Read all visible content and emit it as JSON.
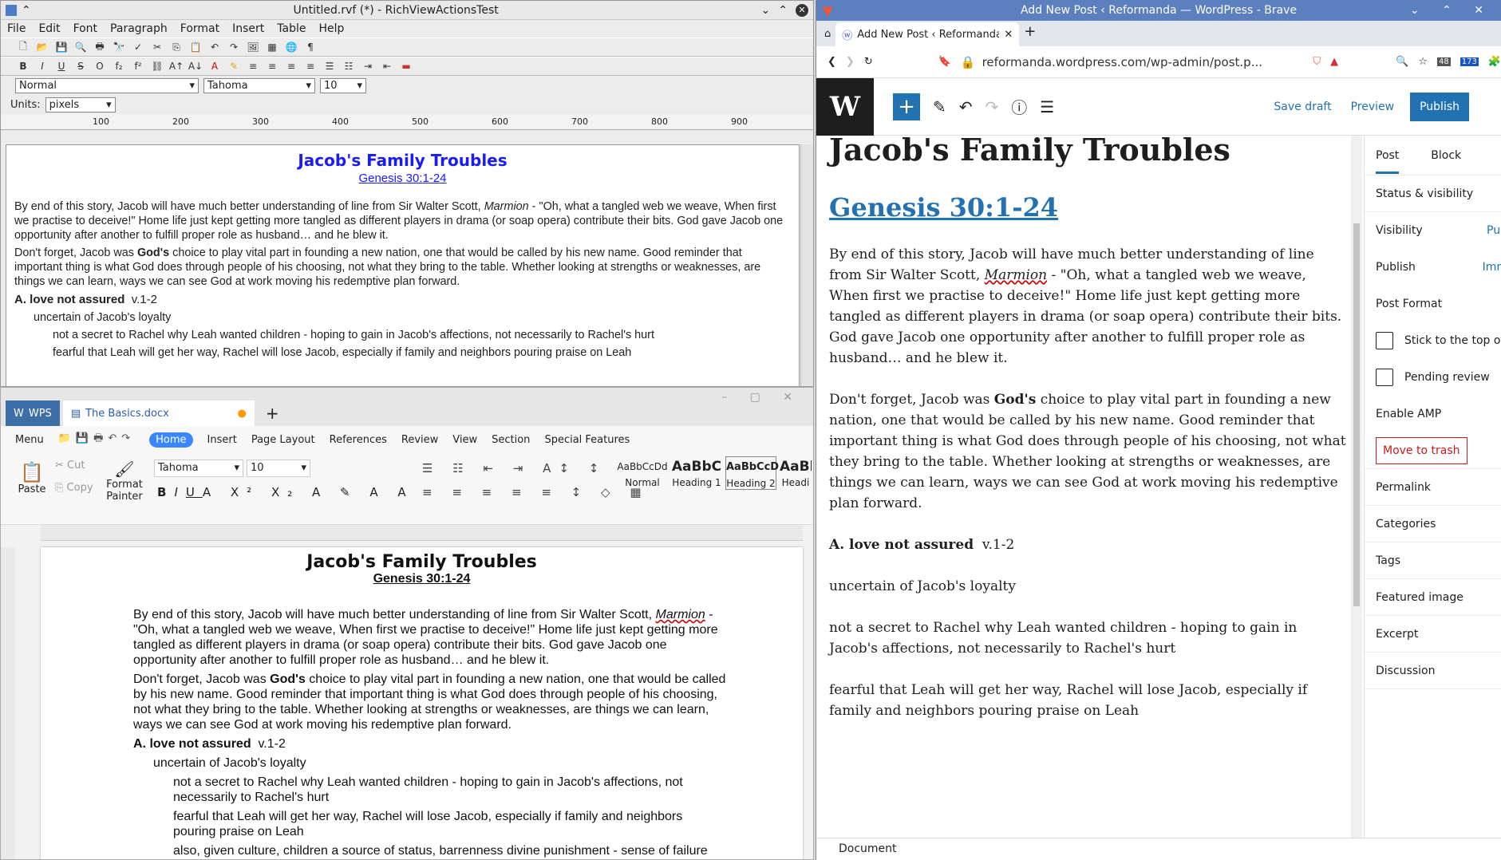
{
  "rv": {
    "title": "Untitled.rvf (*) - RichViewActionsTest",
    "menu": [
      "File",
      "Edit",
      "Font",
      "Paragraph",
      "Format",
      "Insert",
      "Table",
      "Help"
    ],
    "style_value": "Normal",
    "font_value": "Tahoma",
    "size_value": "10",
    "units_label": "Units:",
    "units_value": "pixels",
    "ruler_ticks": [
      "100",
      "200",
      "300",
      "400",
      "500",
      "600",
      "700",
      "800",
      "900"
    ],
    "doc": {
      "title": "Jacob's Family Troubles",
      "subtitle": "Genesis 30:1-24",
      "p1a": "By end of this story, Jacob will have much better understanding of line from Sir Walter Scott, ",
      "p1i": "Marmion",
      "p1b": " - \"Oh, what a tangled web we weave, When first we practise to deceive!\" Home life just kept getting more tangled as different players in drama (or soap opera) contribute their bits. God gave Jacob one opportunity after another to fulfill proper role as husband… and he blew it.",
      "p2a": "Don't forget, Jacob was ",
      "p2b": "God's",
      "p2c": " choice to play vital part in founding a new nation, one that would be called by his new name. Good reminder that important thing is what God does through people of his choosing, not what they bring to the table. Whether looking at strengths or weaknesses, are things we can learn, ways we can see God at work moving his redemptive plan forward.",
      "h_a": "A. love not assured",
      "h_v": "v.1-2",
      "l1": "uncertain of Jacob's loyalty",
      "l2": "not a secret to Rachel why Leah wanted children - hoping to gain in Jacob's affections, not necessarily to Rachel's hurt",
      "l3": "fearful that Leah will get her way, Rachel will lose Jacob, especially if family and neighbors pouring praise on Leah"
    }
  },
  "wps": {
    "app_tab": "WPS",
    "doc_tab": "The Basics.docx",
    "menu": [
      "Menu",
      "Home",
      "Insert",
      "Page Layout",
      "References",
      "Review",
      "View",
      "Section",
      "Special Features"
    ],
    "paste": "Paste",
    "cut": "Cut",
    "copy": "Copy",
    "format_painter": "Format Painter",
    "font": "Tahoma",
    "size": "10",
    "styles": [
      {
        "preview": "AaBbCcDd",
        "name": "Normal"
      },
      {
        "preview": "AaBbC",
        "name": "Heading 1"
      },
      {
        "preview": "AaBbCcD",
        "name": "Heading 2"
      },
      {
        "preview": "AaBl",
        "name": "Headi"
      }
    ],
    "l4": "also, given culture, children a source of status, barrenness divine punishment - sense of failure"
  },
  "brave": {
    "window_title": "Add New Post ‹ Reformanda — WordPress - Brave",
    "tab_title": "Add New Post ‹ Reformanda –",
    "url": "reformanda.wordpress.com/wp-admin/post.p...",
    "badge1": "48",
    "badge2": "173",
    "save_draft": "Save draft",
    "preview": "Preview",
    "publish": "Publish",
    "side_tabs": [
      "Post",
      "Block"
    ],
    "side": {
      "status": "Status & visibility",
      "visibility": "Visibility",
      "visibility_val": "Pub",
      "publish": "Publish",
      "publish_val": "Imm",
      "post_format": "Post Format",
      "stick": "Stick to the top of",
      "pending": "Pending review",
      "amp": "Enable AMP",
      "trash": "Move to trash",
      "permalink": "Permalink",
      "categories": "Categories",
      "tags": "Tags",
      "featured": "Featured image",
      "excerpt": "Excerpt",
      "discussion": "Discussion"
    },
    "footer": "Document"
  },
  "colors": {
    "rv_title_blue": "#1a1aff",
    "wp_blue": "#2271b1",
    "brave_title": "#5b7fbf",
    "wps_home": "#3a86ff",
    "trash_red": "#cc1818"
  }
}
